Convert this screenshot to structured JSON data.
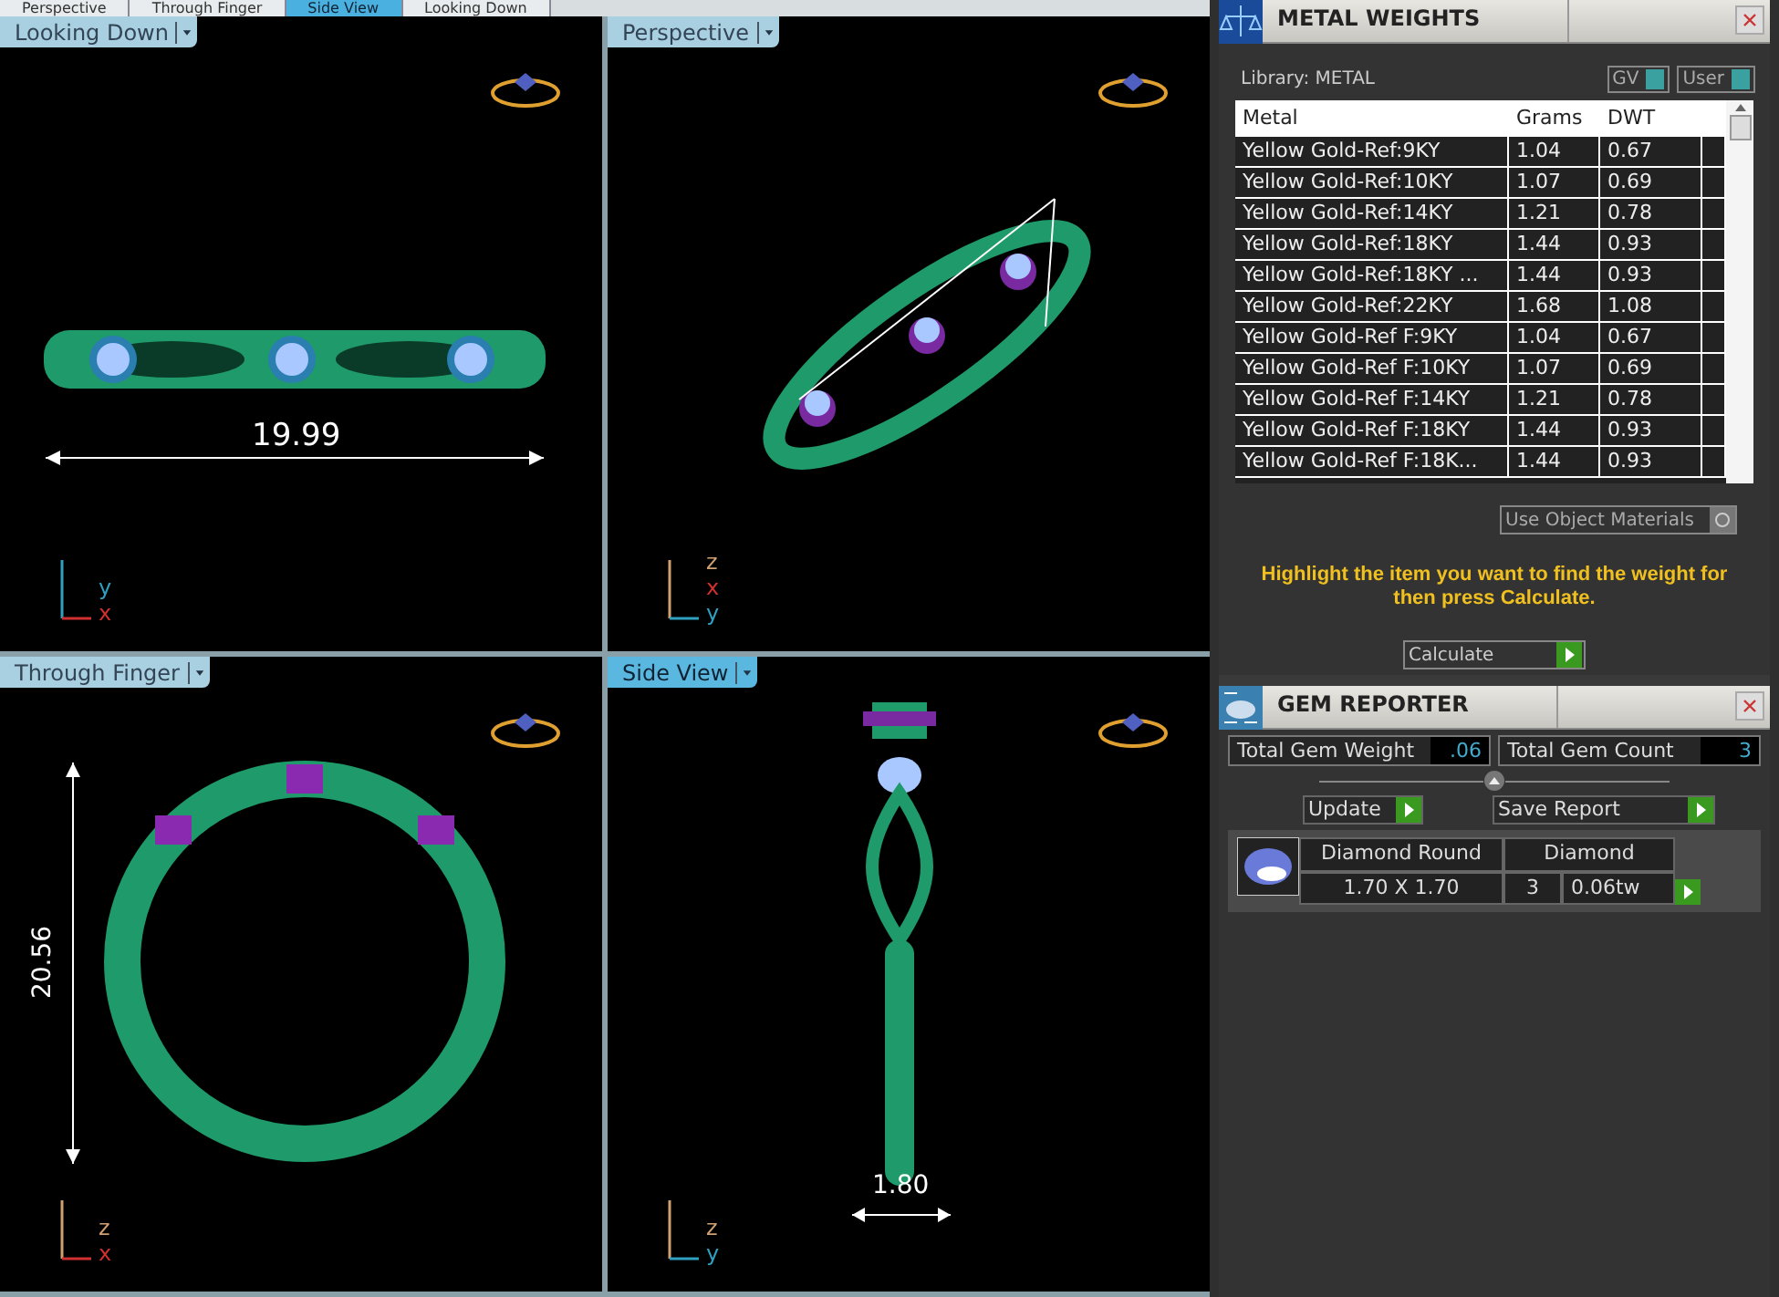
{
  "view_tabs": [
    {
      "label": "Perspective",
      "selected": false
    },
    {
      "label": "Through Finger",
      "selected": false
    },
    {
      "label": "Side View",
      "selected": true
    },
    {
      "label": "Looking Down",
      "selected": false
    }
  ],
  "viewports": [
    {
      "label": "Looking Down",
      "selected": false,
      "kind": "top",
      "dimension": "19.99",
      "axes": [
        "y",
        "x"
      ]
    },
    {
      "label": "Perspective",
      "selected": false,
      "kind": "perspective",
      "axes": [
        "z",
        "x",
        "y"
      ]
    },
    {
      "label": "Through Finger",
      "selected": false,
      "kind": "finger",
      "dimension": "20.56",
      "axes": [
        "z",
        "x"
      ]
    },
    {
      "label": "Side View",
      "selected": true,
      "kind": "side",
      "dimension": "1.80",
      "axes": [
        "z",
        "y"
      ]
    }
  ],
  "metal_weights": {
    "title": "METAL WEIGHTS",
    "library": "Library: METAL",
    "toggles": [
      {
        "label": "GV",
        "on": true
      },
      {
        "label": "User",
        "on": true
      }
    ],
    "columns": [
      "Metal",
      "Grams",
      "DWT"
    ],
    "rows": [
      {
        "cells": [
          "Yellow Gold-Ref:9KY",
          "1.04",
          "0.67"
        ]
      },
      {
        "cells": [
          "Yellow Gold-Ref:10KY",
          "1.07",
          "0.69"
        ]
      },
      {
        "cells": [
          "Yellow Gold-Ref:14KY",
          "1.21",
          "0.78"
        ]
      },
      {
        "cells": [
          "Yellow Gold-Ref:18KY",
          "1.44",
          "0.93"
        ]
      },
      {
        "cells": [
          "Yellow Gold-Ref:18KY ...",
          "1.44",
          "0.93"
        ]
      },
      {
        "cells": [
          "Yellow Gold-Ref:22KY",
          "1.68",
          "1.08"
        ]
      },
      {
        "cells": [
          "Yellow Gold-Ref F:9KY",
          "1.04",
          "0.67"
        ]
      },
      {
        "cells": [
          "Yellow Gold-Ref F:10KY",
          "1.07",
          "0.69"
        ]
      },
      {
        "cells": [
          "Yellow Gold-Ref F:14KY",
          "1.21",
          "0.78"
        ]
      },
      {
        "cells": [
          "Yellow Gold-Ref F:18KY",
          "1.44",
          "0.93"
        ]
      },
      {
        "cells": [
          "Yellow Gold-Ref F:18K...",
          "1.44",
          "0.93"
        ]
      }
    ],
    "use_object_materials": "Use Object Materials",
    "hint": "Highlight the item you want to find the weight for then press Calculate.",
    "calculate": "Calculate"
  },
  "gem_reporter": {
    "title": "GEM REPORTER",
    "stats": [
      {
        "label": "Total Gem Weight",
        "value": ".06"
      },
      {
        "label": "Total Gem Count",
        "value": "3"
      }
    ],
    "buttons": [
      "Update",
      "Save Report"
    ],
    "gem": {
      "shape": "Diamond Round",
      "type": "Diamond",
      "size": "1.70 X 1.70",
      "count": "3",
      "weight": "0.06tw"
    }
  }
}
